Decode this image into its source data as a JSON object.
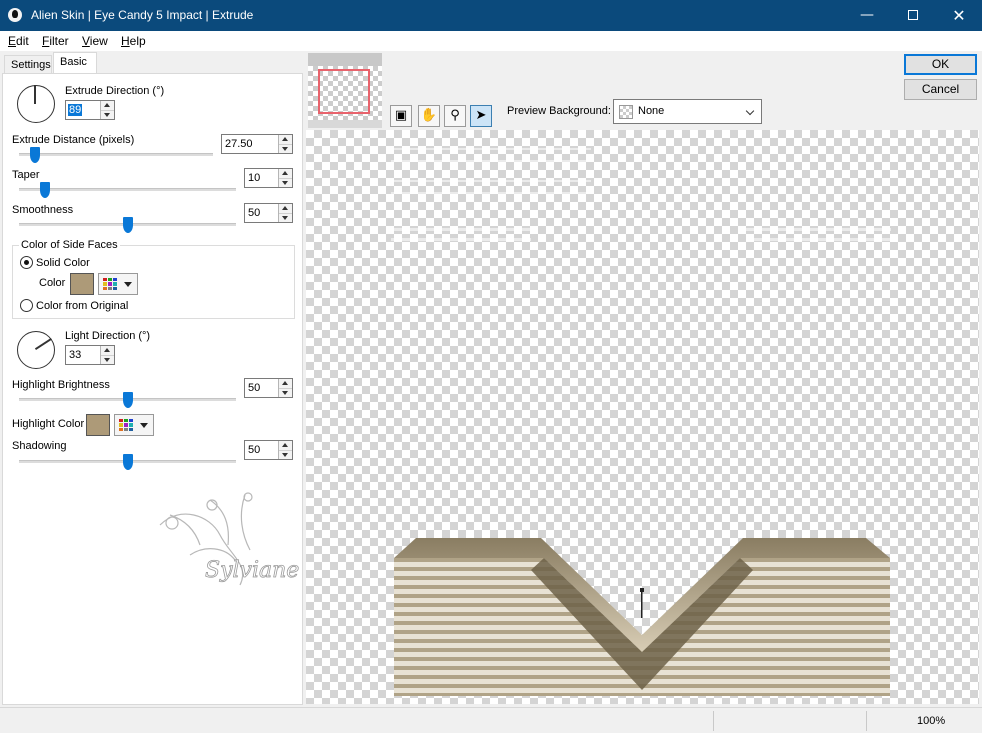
{
  "window": {
    "title": "Alien Skin | Eye Candy 5 Impact | Extrude"
  },
  "menu": [
    {
      "label": "Edit"
    },
    {
      "label": "Filter"
    },
    {
      "label": "View"
    },
    {
      "label": "Help"
    }
  ],
  "tabs": [
    {
      "label": "Settings"
    },
    {
      "label": "Basic"
    }
  ],
  "basic": {
    "extrude_direction": {
      "label": "Extrude Direction (°)",
      "value": "89"
    },
    "extrude_distance": {
      "label": "Extrude Distance (pixels)",
      "value": "27.50",
      "slider_fraction": 0.08
    },
    "taper": {
      "label": "Taper",
      "value": "10",
      "slider_fraction": 0.12
    },
    "smoothness": {
      "label": "Smoothness",
      "value": "50",
      "slider_fraction": 0.5
    },
    "side_faces": {
      "group_title": "Color of Side Faces",
      "solid_color_label": "Solid Color",
      "color_label": "Color",
      "color_value": "#ad9a78",
      "from_original_label": "Color from Original",
      "selected": "solid"
    },
    "light_direction": {
      "label": "Light Direction (°)",
      "value": "33"
    },
    "highlight_brightness": {
      "label": "Highlight Brightness",
      "value": "50",
      "slider_fraction": 0.5
    },
    "highlight_color": {
      "label": "Highlight Color",
      "color_value": "#ad9a78"
    },
    "shadowing": {
      "label": "Shadowing",
      "value": "50",
      "slider_fraction": 0.5
    }
  },
  "preview": {
    "background_label": "Preview Background:",
    "background_value": "None",
    "tools": [
      "preview-swap-icon",
      "hand-icon",
      "zoom-icon",
      "arrow-pointer-icon"
    ],
    "active_tool": "arrow-pointer-icon"
  },
  "buttons": {
    "ok": "OK",
    "cancel": "Cancel"
  },
  "status": {
    "zoom": "100%"
  },
  "watermark": {
    "text": "Sylviane"
  }
}
